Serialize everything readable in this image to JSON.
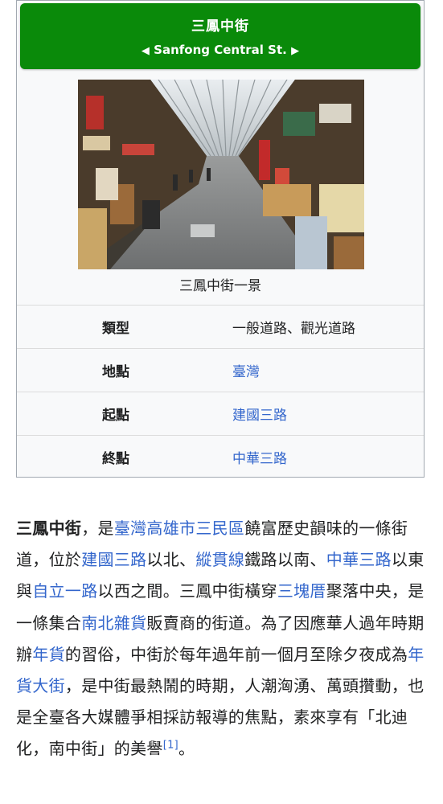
{
  "infobox": {
    "title_zh": "三鳳中街",
    "title_en": "Sanfong Central St.",
    "left_arrow": "◀",
    "right_arrow": "▶",
    "caption": "三鳳中街一景",
    "rows": [
      {
        "label": "類型",
        "value": "一般道路、觀光道路",
        "link": false
      },
      {
        "label": "地點",
        "value": "臺灣",
        "link": true
      },
      {
        "label": "起點",
        "value": "建國三路",
        "link": true
      },
      {
        "label": "終點",
        "value": "中華三路",
        "link": true
      }
    ]
  },
  "article": {
    "segments": [
      {
        "text": "三鳳中街",
        "bold": true
      },
      {
        "text": "，是"
      },
      {
        "text": "臺灣",
        "link": true
      },
      {
        "text": "高雄市",
        "link": true
      },
      {
        "text": "三民區",
        "link": true
      },
      {
        "text": "饒富歷史韻味的一條街道，位於"
      },
      {
        "text": "建國三路",
        "link": true
      },
      {
        "text": "以北、"
      },
      {
        "text": "縱貫線",
        "link": true
      },
      {
        "text": "鐵路以南、"
      },
      {
        "text": "中華三路",
        "link": true
      },
      {
        "text": "以東與"
      },
      {
        "text": "自立一路",
        "link": true
      },
      {
        "text": "以西之間。三鳳中街橫穿"
      },
      {
        "text": "三塊厝",
        "link": true
      },
      {
        "text": "聚落中央，是一條集合"
      },
      {
        "text": "南北雜貨",
        "link": true
      },
      {
        "text": "販賣商的街道。為了因應華人過年時期辦"
      },
      {
        "text": "年貨",
        "link": true
      },
      {
        "text": "的習俗，中街於每年過年前一個月至除夕夜成為"
      },
      {
        "text": "年貨大街",
        "link": true
      },
      {
        "text": "，是中街最熱鬧的時期，人潮洶湧、萬頭攢動，也是全臺各大媒體爭相採訪報導的焦點，素來享有「北迪化，南中街」的美譽"
      },
      {
        "text": "[1]",
        "link": true,
        "sup": true
      },
      {
        "text": "。"
      }
    ]
  },
  "colors": {
    "banner": "#0a8a0a",
    "link": "#3366cc"
  },
  "icons": {
    "left_arrow": "left-triangle-icon",
    "right_arrow": "right-triangle-icon"
  }
}
